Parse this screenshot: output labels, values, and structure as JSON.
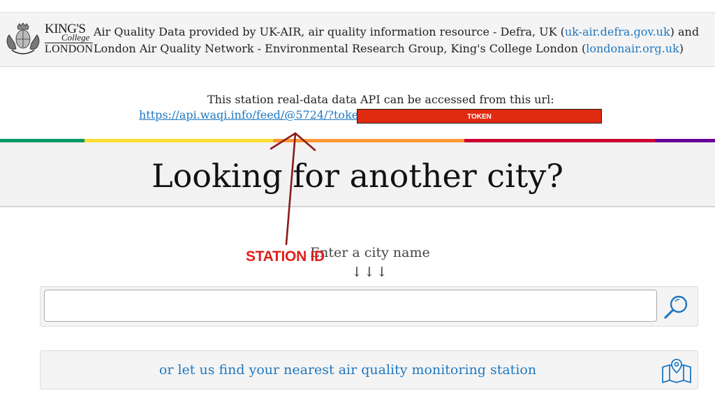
{
  "attribution": {
    "logo_alt": "King's College London",
    "logo_kings": "KING'S",
    "logo_college": "College",
    "logo_london": "LONDON",
    "text_part1": "Air Quality Data provided by UK-AIR, air quality information resource - Defra, UK (",
    "link1": "uk-air.defra.gov.uk",
    "text_part2": ") and London Air Quality Network - Environmental Research Group, King's College London (",
    "link2": "londonair.org.uk",
    "text_part3": ")"
  },
  "api": {
    "intro": "This station real-data data API can be accessed from this url:",
    "url": "https://api.waqi.info/feed/@5724/?token=",
    "token_label": "TOKEN"
  },
  "rainbow_colors": [
    "#009966",
    "#ffde33",
    "#ff9933",
    "#cc0033",
    "#660099"
  ],
  "hero": {
    "title": "Looking for another city?"
  },
  "search": {
    "prompt": "Enter a city name",
    "arrows": "↓↓↓",
    "input_value": "",
    "input_placeholder": "",
    "button_icon": "search-icon"
  },
  "nearest": {
    "label": "or let us find your nearest air quality monitoring station",
    "icon": "map-location-icon"
  },
  "annotation": {
    "label": "STATION ID",
    "color": "#e0201a"
  },
  "colors": {
    "link": "#1f78c1",
    "token_bg": "#e02a11",
    "panel_bg": "#f4f4f4"
  }
}
